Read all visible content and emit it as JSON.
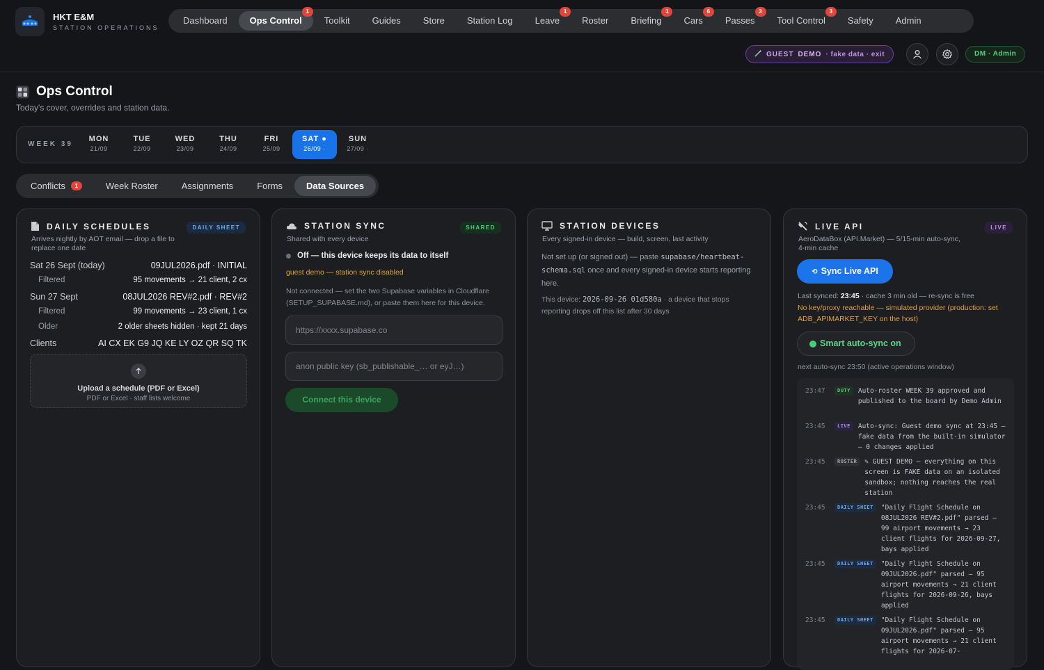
{
  "brand": {
    "name": "HKT E&M",
    "sub": "STATION OPERATIONS"
  },
  "nav": [
    {
      "label": "Dashboard",
      "badge": ""
    },
    {
      "label": "Ops Control",
      "badge": "1",
      "active": true
    },
    {
      "label": "Toolkit",
      "badge": ""
    },
    {
      "label": "Guides",
      "badge": ""
    },
    {
      "label": "Store",
      "badge": ""
    },
    {
      "label": "Station Log",
      "badge": ""
    },
    {
      "label": "Leave",
      "badge": "1"
    },
    {
      "label": "Roster",
      "badge": ""
    },
    {
      "label": "Briefing",
      "badge": "1"
    },
    {
      "label": "Cars",
      "badge": "6"
    },
    {
      "label": "Passes",
      "badge": "3"
    },
    {
      "label": "Tool Control",
      "badge": "3"
    },
    {
      "label": "Safety",
      "badge": ""
    },
    {
      "label": "Admin",
      "badge": ""
    }
  ],
  "guest": {
    "label": "GUEST",
    "demo": "DEMO",
    "fake": "· fake data · exit"
  },
  "user": {
    "role": "DM · Admin"
  },
  "page": {
    "title": "Ops Control",
    "subtitle": "Today's cover, overrides and station data."
  },
  "week": {
    "label": "WEEK 39",
    "days": [
      {
        "name": "MON",
        "date": "21/09"
      },
      {
        "name": "TUE",
        "date": "22/09"
      },
      {
        "name": "WED",
        "date": "23/09"
      },
      {
        "name": "THU",
        "date": "24/09"
      },
      {
        "name": "FRI",
        "date": "25/09"
      },
      {
        "name": "SAT ●",
        "date": "26/09 ·",
        "active": true
      },
      {
        "name": "SUN",
        "date": "27/09 ·"
      }
    ]
  },
  "subtabs": [
    {
      "label": "Conflicts",
      "badge": "1"
    },
    {
      "label": "Week Roster"
    },
    {
      "label": "Assignments"
    },
    {
      "label": "Forms"
    },
    {
      "label": "Data Sources",
      "active": true
    }
  ],
  "daily": {
    "title": "DAILY SCHEDULES",
    "tag": "DAILY SHEET",
    "desc": "Arrives nightly by AOT email — drop a file to replace one date",
    "rows": [
      {
        "k": "Sat 26 Sept (today)",
        "v": "09JUL2026.pdf · INITIAL"
      },
      {
        "k": "Filtered",
        "v": "95 movements → 21 client, 2 cx",
        "sub": true
      },
      {
        "k": "Sun 27 Sept",
        "v": "08JUL2026 REV#2.pdf · REV#2"
      },
      {
        "k": "Filtered",
        "v": "99 movements → 23 client, 1 cx",
        "sub": true
      },
      {
        "k": "Older",
        "v": "2 older sheets hidden · kept 21 days",
        "sub": true
      },
      {
        "k": "Clients",
        "v": "AI CX EK G9 JQ KE LY OZ QR SQ TK"
      }
    ],
    "upload_title": "Upload a schedule (PDF or Excel)",
    "upload_sub": "PDF or Excel · staff lists welcome"
  },
  "sync": {
    "title": "STATION SYNC",
    "tag": "SHARED",
    "desc": "Shared with every device",
    "status": "Off — this device keeps its data to itself",
    "guest_note": "guest demo — station sync disabled",
    "note": "Not connected — set the two Supabase variables in Cloudflare (SETUP_SUPABASE.md), or paste them here for this device.",
    "url_placeholder": "https://xxxx.supabase.co",
    "key_placeholder": "anon public key (sb_publishable_… or eyJ…)",
    "connect": "Connect this device"
  },
  "devices": {
    "title": "STATION DEVICES",
    "desc": "Every signed-in device — build, screen, last activity",
    "p1a": "Not set up (or signed out) — paste ",
    "p1code": "supabase/heartbeat-schema.sql",
    "p1b": " once and every signed-in device starts reporting here.",
    "p2a": "This device: ",
    "p2code": "2026-09-26 01d580a",
    "p2b": " · a device that stops reporting drops off this list after 30 days"
  },
  "live": {
    "title": "LIVE API",
    "tag": "LIVE",
    "desc": "AeroDataBox (API.Market) — 5/15-min auto-sync, 4-min cache",
    "sync_btn": "Sync Live API",
    "synced_pre": "Last synced: ",
    "synced_time": "23:45",
    "synced_post": " · cache 3 min old — re-sync is free",
    "warning": "No key/proxy reachable — simulated provider (production: set ADB_APIMARKET_KEY on the host)",
    "smart": "Smart auto-sync on",
    "next": "next auto-sync 23:50 (active operations window)",
    "log": [
      {
        "time": "23:47",
        "tag": "DUTY",
        "cls": "lt-duty",
        "text": "Auto-roster WEEK 39 approved and published to the board by Demo Admin"
      },
      {
        "time": "23:45",
        "tag": "LIVE",
        "cls": "lt-live",
        "text": "Auto-sync: Guest demo sync at 23:45 — fake data from the built-in simulator — 0 changes applied"
      },
      {
        "time": "23:45",
        "tag": "ROSTER",
        "cls": "lt-roster",
        "text": "✎ GUEST DEMO — everything on this screen is FAKE data on an isolated sandbox; nothing reaches the real station"
      },
      {
        "time": "23:45",
        "tag": "DAILY SHEET",
        "cls": "lt-sheet",
        "text": "\"Daily Flight Schedule on 08JUL2026 REV#2.pdf\" parsed — 99 airport movements → 23 client flights for 2026-09-27, bays applied"
      },
      {
        "time": "23:45",
        "tag": "DAILY SHEET",
        "cls": "lt-sheet",
        "text": "\"Daily Flight Schedule on 09JUL2026.pdf\" parsed — 95 airport movements → 21 client flights for 2026-09-26, bays applied"
      },
      {
        "time": "23:45",
        "tag": "DAILY SHEET",
        "cls": "lt-sheet",
        "text": "\"Daily Flight Schedule on 09JUL2026.pdf\" parsed — 95 airport movements → 21 client flights for 2026-07-"
      }
    ]
  },
  "icons": [
    "crown-logo",
    "user-icon",
    "gear-icon",
    "wand-icon",
    "ops-icon",
    "document-icon",
    "cloud-icon",
    "monitor-icon",
    "satellite-icon",
    "upload-icon",
    "refresh-icon"
  ]
}
